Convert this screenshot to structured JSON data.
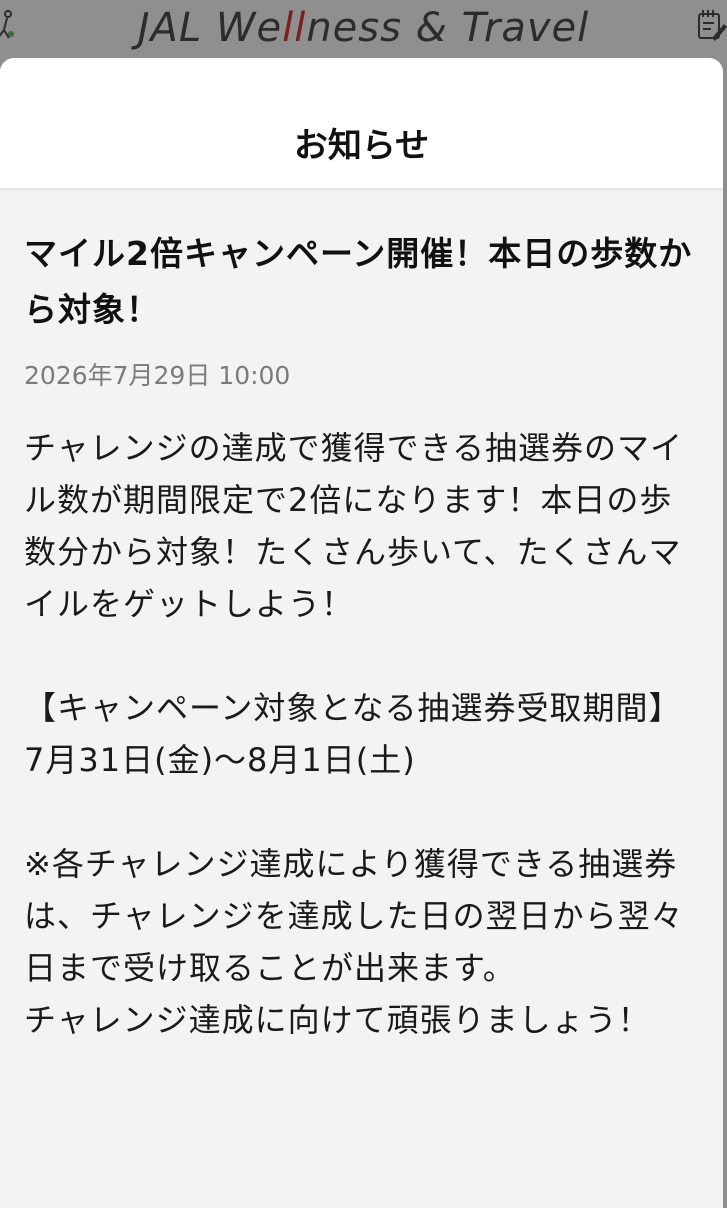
{
  "app": {
    "logo_pre": "JAL We",
    "logo_l1": "l",
    "logo_l2": "l",
    "logo_post": "ness & Travel"
  },
  "modal": {
    "title": "お知らせ"
  },
  "notice": {
    "title": "マイル2倍キャンペーン開催！本日の歩数から対象！",
    "date": "2026年7月29日 10:00",
    "paragraph1": "チャレンジの達成で獲得できる抽選券のマイル数が期間限定で2倍になります！本日の歩数分から対象！たくさん歩いて、たくさんマイルをゲットしよう！",
    "period_heading": "【キャンペーン対象となる抽選券受取期間】",
    "period_value": "7月31日(金)〜8月1日(土)",
    "note": "※各チャレンジ達成により獲得できる抽選券は、チャレンジを達成した日の翌日から翌々日まで受け取ることが出来ます。",
    "closing": "チャレンジ達成に向けて頑張りましょう！"
  },
  "colors": {
    "header_bg": "#8f8f8f",
    "logo_accent": "#7a1f1f",
    "date_text": "#7b7b7b"
  },
  "icons": {
    "left": "walking-figure-icon",
    "right": "notepad-edit-icon"
  }
}
